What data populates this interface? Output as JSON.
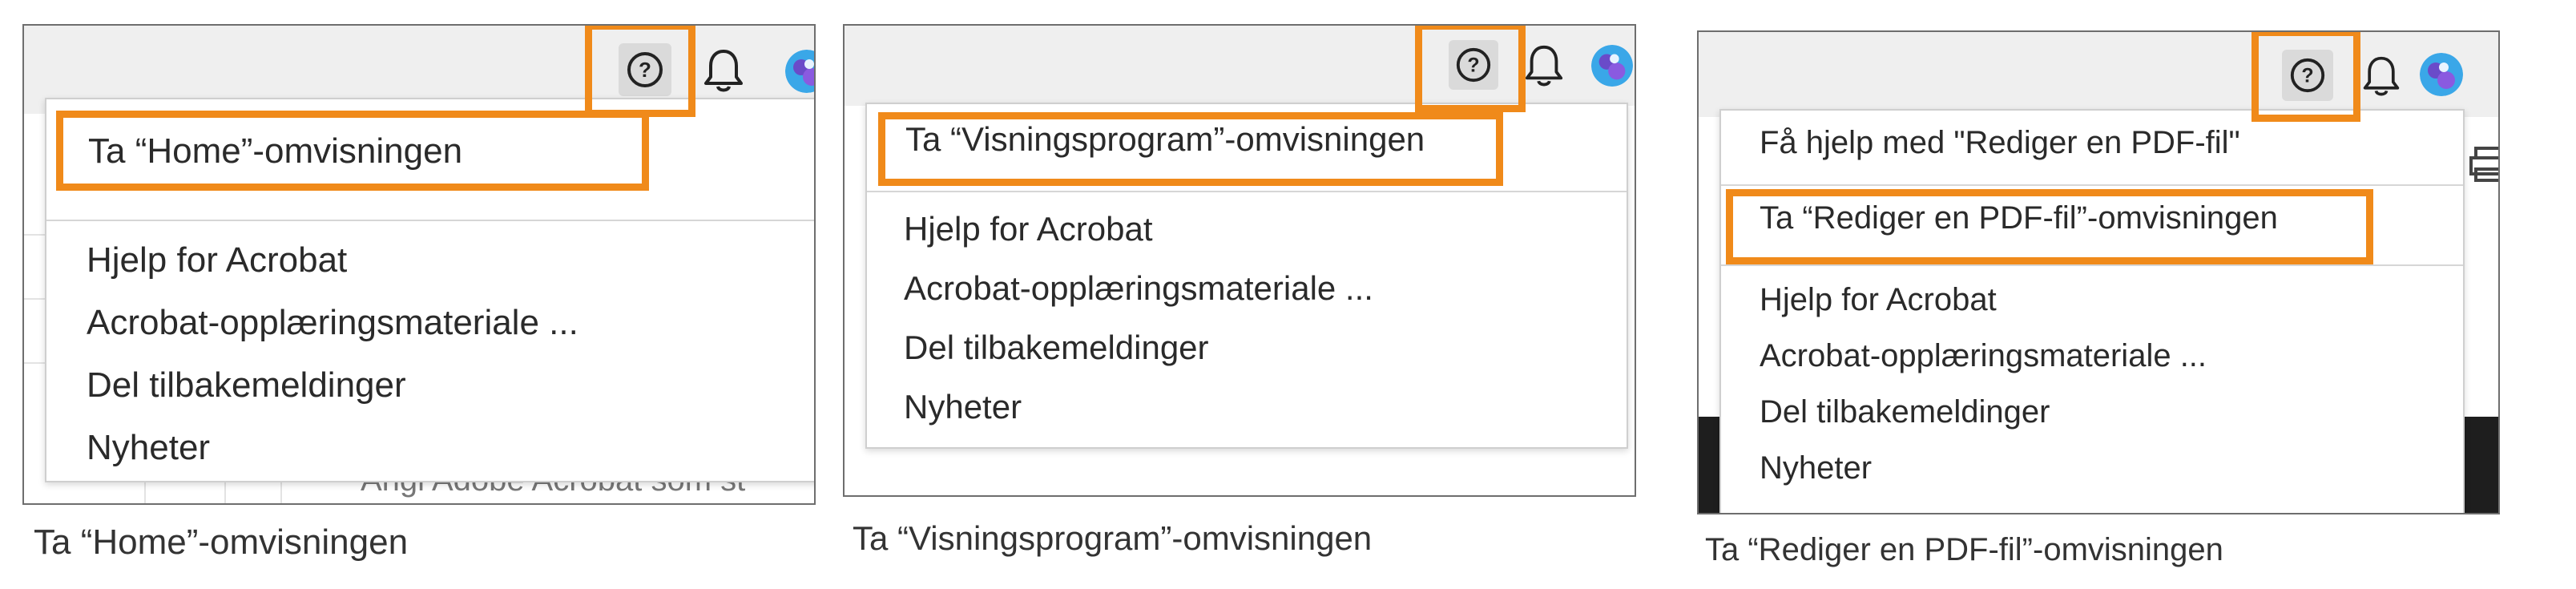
{
  "icons": {
    "help": "help-circle-icon",
    "bell": "bell-icon",
    "avatar": "avatar",
    "print": "printer-icon"
  },
  "colors": {
    "highlight": "#f08a1a",
    "topbar": "#efefef",
    "help_button": "#dadada"
  },
  "panels": [
    {
      "tour_item": "Ta “Home”-omvisningen",
      "menu": [
        "Hjelp for Acrobat",
        "Acrobat-opplæringsmateriale ...",
        "Del tilbakemeldinger",
        "Nyheter"
      ],
      "background_text": "Angi Adobe Acrobat som st",
      "caption": "Ta “Home”-omvisningen"
    },
    {
      "tour_item": "Ta “Visningsprogram”-omvisningen",
      "menu": [
        "Hjelp for Acrobat",
        "Acrobat-opplæringsmateriale ...",
        "Del tilbakemeldinger",
        "Nyheter"
      ],
      "caption": "Ta “Visningsprogram”-omvisningen"
    },
    {
      "help_item": "Få hjelp med \"Rediger en PDF-fil\"",
      "tour_item": "Ta “Rediger en PDF-fil”-omvisningen",
      "menu": [
        "Hjelp for Acrobat",
        "Acrobat-opplæringsmateriale ...",
        "Del tilbakemeldinger",
        "Nyheter"
      ],
      "caption": "Ta “Rediger en PDF-fil”-omvisningen"
    }
  ]
}
